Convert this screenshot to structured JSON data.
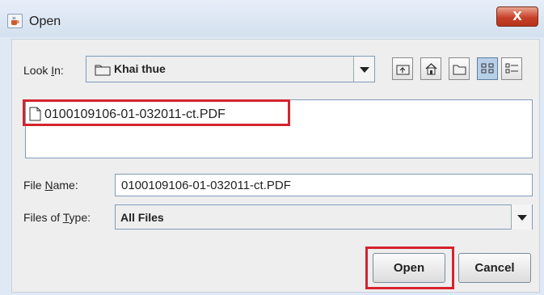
{
  "window": {
    "title": "Open",
    "close_label": "X",
    "icon": "java-cup-icon"
  },
  "look_in": {
    "label_prefix": "Look ",
    "label_mnemonic": "I",
    "label_suffix": "n:",
    "value": "Khai thue",
    "icon": "folder-icon"
  },
  "toolbar": {
    "buttons": [
      "up-one-level-icon",
      "home-icon",
      "new-folder-icon",
      "list-view-icon",
      "details-view-icon"
    ],
    "selected": "list-view-icon"
  },
  "file_list": {
    "items": [
      {
        "name": "0100109106-01-032011-ct.PDF",
        "icon": "file-icon"
      }
    ]
  },
  "file_name": {
    "label_prefix": "File ",
    "label_mnemonic": "N",
    "label_suffix": "ame:",
    "value": "0100109106-01-032011-ct.PDF"
  },
  "file_type": {
    "label_prefix": "Files of ",
    "label_mnemonic": "T",
    "label_suffix": "ype:",
    "value": "All Files"
  },
  "actions": {
    "open_label": "Open",
    "cancel_label": "Cancel"
  },
  "colors": {
    "highlight_box": "#d4232c",
    "close_button": "#c8412a",
    "selected_toolbar": "#b8cfe8"
  }
}
